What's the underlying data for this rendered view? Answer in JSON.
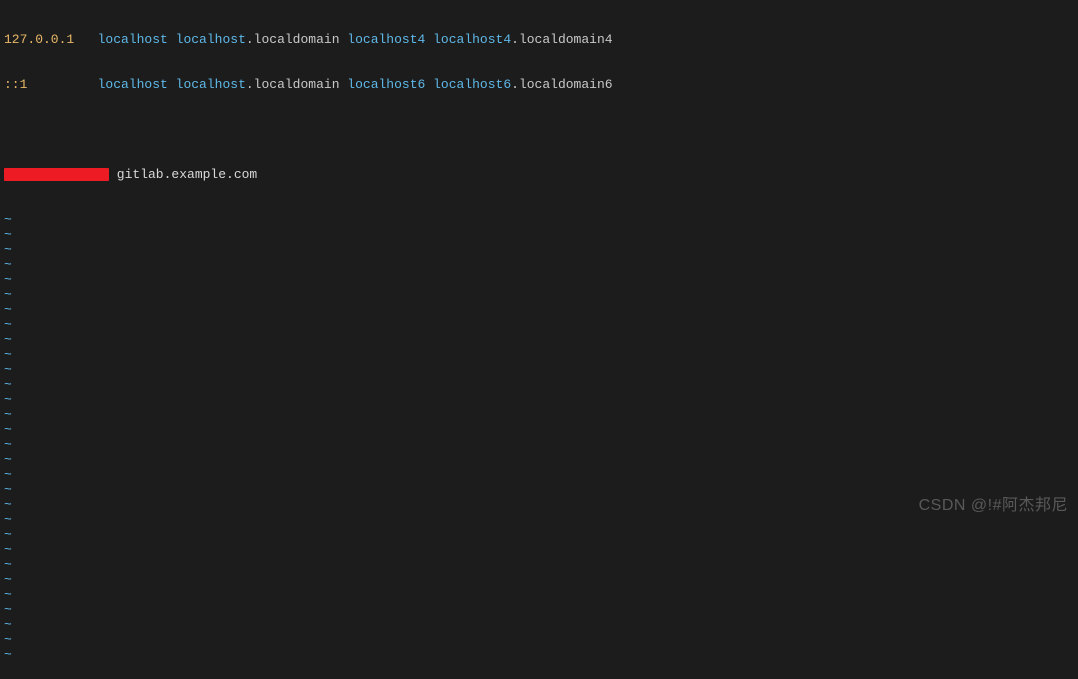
{
  "lines": {
    "l1": {
      "ip": "127.0.0.1",
      "sp1": "   ",
      "h1": "localhost",
      "h2": "localhost",
      "d1": ".localdomain ",
      "h3": "localhost4",
      "sp2": " ",
      "h4": "localhost4",
      "d2": ".localdomain4"
    },
    "l2": {
      "ip": "::1",
      "sp1": "         ",
      "h1": "localhost",
      "h2": "localhost",
      "d1": ".localdomain ",
      "h3": "localhost6",
      "sp2": " ",
      "h4": "localhost6",
      "d2": ".localdomain6"
    },
    "l3": {
      "text": " gitlab.example.com"
    }
  },
  "tilde": "~",
  "tilde_count": 30,
  "watermark": "CSDN @!#阿杰邦尼"
}
